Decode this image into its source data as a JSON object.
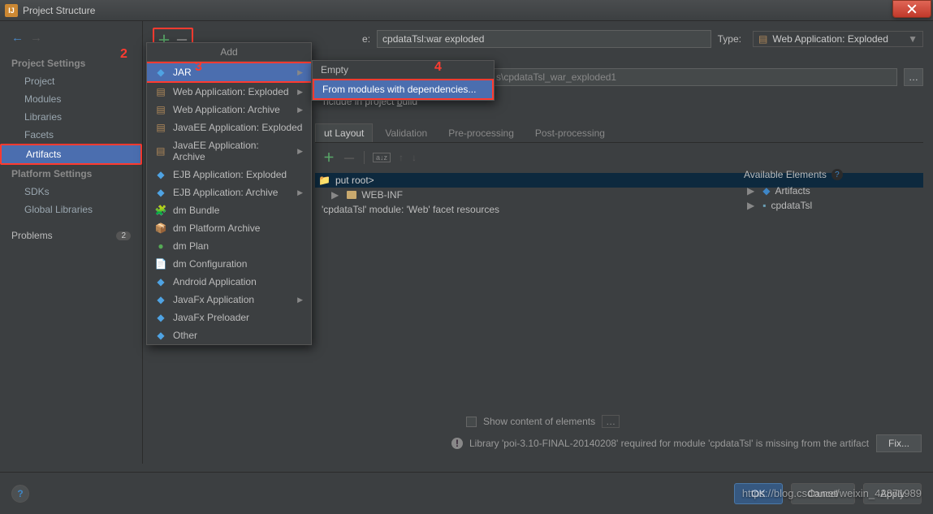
{
  "window": {
    "title": "Project Structure"
  },
  "annotations": {
    "n2": "2",
    "n3": "3",
    "n4": "4"
  },
  "sidebar": {
    "section1": "Project Settings",
    "items1": [
      "Project",
      "Modules",
      "Libraries",
      "Facets",
      "Artifacts"
    ],
    "section2": "Platform Settings",
    "items2": [
      "SDKs",
      "Global Libraries"
    ],
    "problems_label": "Problems",
    "problems_count": "2"
  },
  "toolbar": {
    "name_label": "e:",
    "name_value": "cpdataTsl:war exploded",
    "type_label": "Type:",
    "type_value": "Web Application: Exploded",
    "path_suffix": "s\\cpdataTsl_war_exploded1",
    "include_prefix": "nclude in project ",
    "include_underlined": "b",
    "include_suffix": "uild"
  },
  "tabs": [
    "ut Layout",
    "Validation",
    "Pre-processing",
    "Post-processing"
  ],
  "tree": {
    "root": "put root>",
    "webinf": "WEB-INF",
    "facet": "'cpdataTsl' module: 'Web' facet resources"
  },
  "right": {
    "head": "Available Elements",
    "artifacts": "Artifacts",
    "module": "cpdataTsl"
  },
  "show_content": "Show content of elements",
  "warning": "Library 'poi-3.10-FINAL-20140208' required for module 'cpdataTsl' is missing from the artifact",
  "fix": "Fix...",
  "menu": {
    "title": "Add",
    "items": [
      "JAR",
      "Web Application: Exploded",
      "Web Application: Archive",
      "JavaEE Application: Exploded",
      "JavaEE Application: Archive",
      "EJB Application: Exploded",
      "EJB Application: Archive",
      "dm Bundle",
      "dm Platform Archive",
      "dm Plan",
      "dm Configuration",
      "Android Application",
      "JavaFx Application",
      "JavaFx Preloader",
      "Other"
    ]
  },
  "submenu": {
    "empty": "Empty",
    "from_modules": "From modules with dependencies..."
  },
  "buttons": {
    "ok": "OK",
    "cancel": "Cancel",
    "apply": "Apply"
  },
  "watermark": "https://blog.csdn.net/weixin_42871989"
}
